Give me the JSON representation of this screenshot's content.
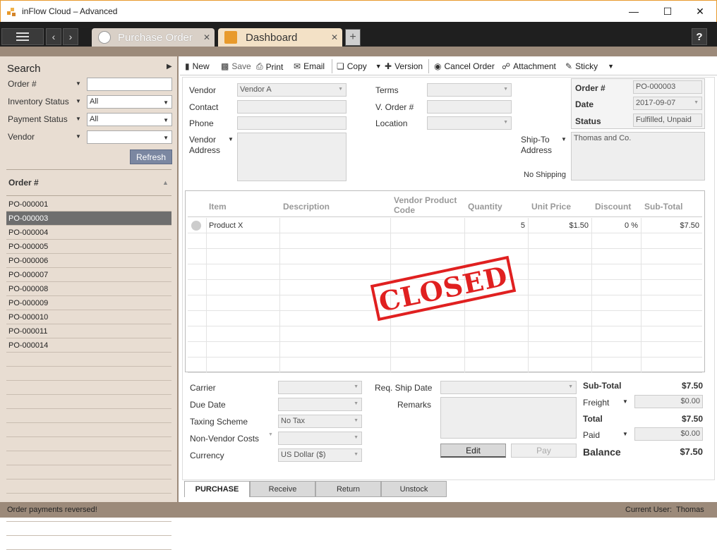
{
  "window": {
    "title": "inFlow Cloud – Advanced",
    "minimize": "—",
    "maximize": "☐",
    "close": "✕"
  },
  "tabs": [
    {
      "label": "Purchase Order",
      "close": "✕"
    },
    {
      "label": "Dashboard",
      "close": "✕"
    }
  ],
  "tabbar": {
    "add": "+",
    "help": "?",
    "back": "‹",
    "forward": "›"
  },
  "search": {
    "title": "Search",
    "filters": [
      {
        "label": "Order #",
        "value": ""
      },
      {
        "label": "Inventory Status",
        "value": "All"
      },
      {
        "label": "Payment Status",
        "value": "All"
      },
      {
        "label": "Vendor",
        "value": ""
      }
    ],
    "refresh": "Refresh",
    "list_header": "Order #",
    "orders": [
      "PO-000001",
      "PO-000003",
      "PO-000004",
      "PO-000005",
      "PO-000006",
      "PO-000007",
      "PO-000008",
      "PO-000009",
      "PO-000010",
      "PO-000011",
      "PO-000014"
    ],
    "selected_index": 1
  },
  "toolbar": {
    "new": "New",
    "save": "Save",
    "print": "Print",
    "email": "Email",
    "copy": "Copy",
    "version": "Version",
    "cancel_order": "Cancel Order",
    "attachment": "Attachment",
    "sticky": "Sticky"
  },
  "order": {
    "vendor_label": "Vendor",
    "vendor_value": "Vendor A",
    "contact_label": "Contact",
    "contact_value": "",
    "phone_label": "Phone",
    "phone_value": "",
    "vendor_address_label_1": "Vendor",
    "vendor_address_label_2": "Address",
    "terms_label": "Terms",
    "terms_value": "",
    "vorder_label": "V. Order #",
    "vorder_value": "",
    "location_label": "Location",
    "location_value": "",
    "shipto_label_1": "Ship-To",
    "shipto_label_2": "Address",
    "shipto_value": "Thomas and Co.",
    "no_shipping": "No Shipping",
    "order_no_label": "Order #",
    "order_no_value": "PO-000003",
    "date_label": "Date",
    "date_value": "2017-09-07",
    "status_label": "Status",
    "status_value": "Fulfilled, Unpaid"
  },
  "grid": {
    "headers": {
      "item": "Item",
      "description": "Description",
      "vendor_code_1": "Vendor Product",
      "vendor_code_2": "Code",
      "quantity": "Quantity",
      "unit_price": "Unit Price",
      "discount": "Discount",
      "subtotal": "Sub-Total"
    },
    "rows": [
      {
        "item": "Product X",
        "description": "",
        "vendor_code": "",
        "quantity": "5",
        "unit_price": "$1.50",
        "discount": "0 %",
        "subtotal": "$7.50"
      }
    ],
    "stamp": "CLOSED"
  },
  "footer": {
    "carrier_label": "Carrier",
    "carrier_value": "",
    "due_date_label": "Due Date",
    "due_date_value": "",
    "taxing_label": "Taxing Scheme",
    "taxing_value": "No Tax",
    "nonvendor_label": "Non-Vendor Costs",
    "nonvendor_value": "",
    "currency_label": "Currency",
    "currency_value": "US Dollar ($)",
    "req_ship_label": "Req. Ship Date",
    "req_ship_value": "",
    "remarks_label": "Remarks",
    "remarks_value": "",
    "edit": "Edit",
    "pay": "Pay"
  },
  "totals": {
    "subtotal_label": "Sub-Total",
    "subtotal_value": "$7.50",
    "freight_label": "Freight",
    "freight_value": "$0.00",
    "total_label": "Total",
    "total_value": "$7.50",
    "paid_label": "Paid",
    "paid_value": "$0.00",
    "balance_label": "Balance",
    "balance_value": "$7.50"
  },
  "bottom_tabs": [
    "PURCHASE",
    "Receive",
    "Return",
    "Unstock"
  ],
  "status": {
    "message": "Order payments reversed!",
    "user_label": "Current User:",
    "user": "Thomas"
  },
  "colors": {
    "accent_orange": "#e89a2c",
    "sidebar_bg": "#e8ddd2",
    "chrome_brown": "#9c8a7a",
    "selected_row": "#6e6e6e",
    "stamp_red": "#e02020"
  }
}
